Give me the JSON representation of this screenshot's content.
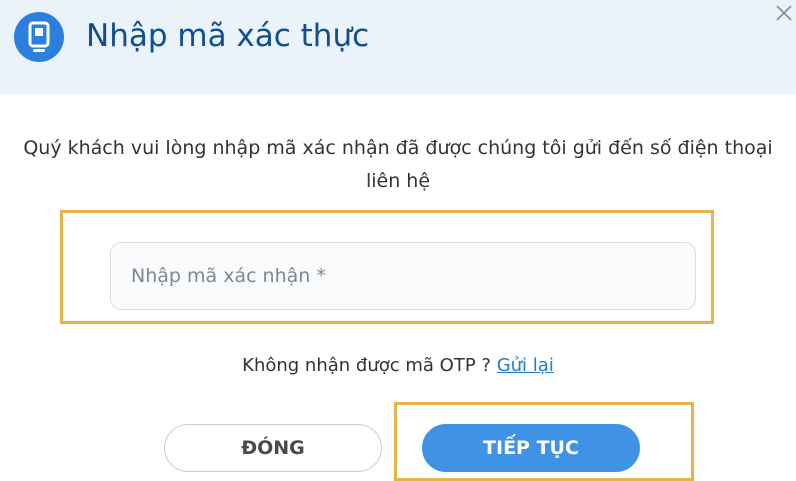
{
  "dialog": {
    "title": "Nhập mã xác thực",
    "header_icon": "mobile-phone-icon",
    "close_icon": "close-icon",
    "message": "Quý khách vui lòng nhập mã xác nhận đã được chúng tôi gửi đến số điện thoại liên hệ",
    "input": {
      "placeholder": "Nhập mã xác nhận *",
      "value": ""
    },
    "resend": {
      "text": "Không nhận được mã OTP ?",
      "link": "Gửi lại"
    },
    "buttons": {
      "close": "ĐÓNG",
      "continue": "TIẾP TỤC"
    }
  },
  "colors": {
    "header_bg": "#eaf2fa",
    "title": "#0f4f8f",
    "icon_bg": "#2d7fde",
    "primary_button": "#3f92e4",
    "link": "#1f7ec9",
    "highlight_border": "#e3b44a"
  }
}
